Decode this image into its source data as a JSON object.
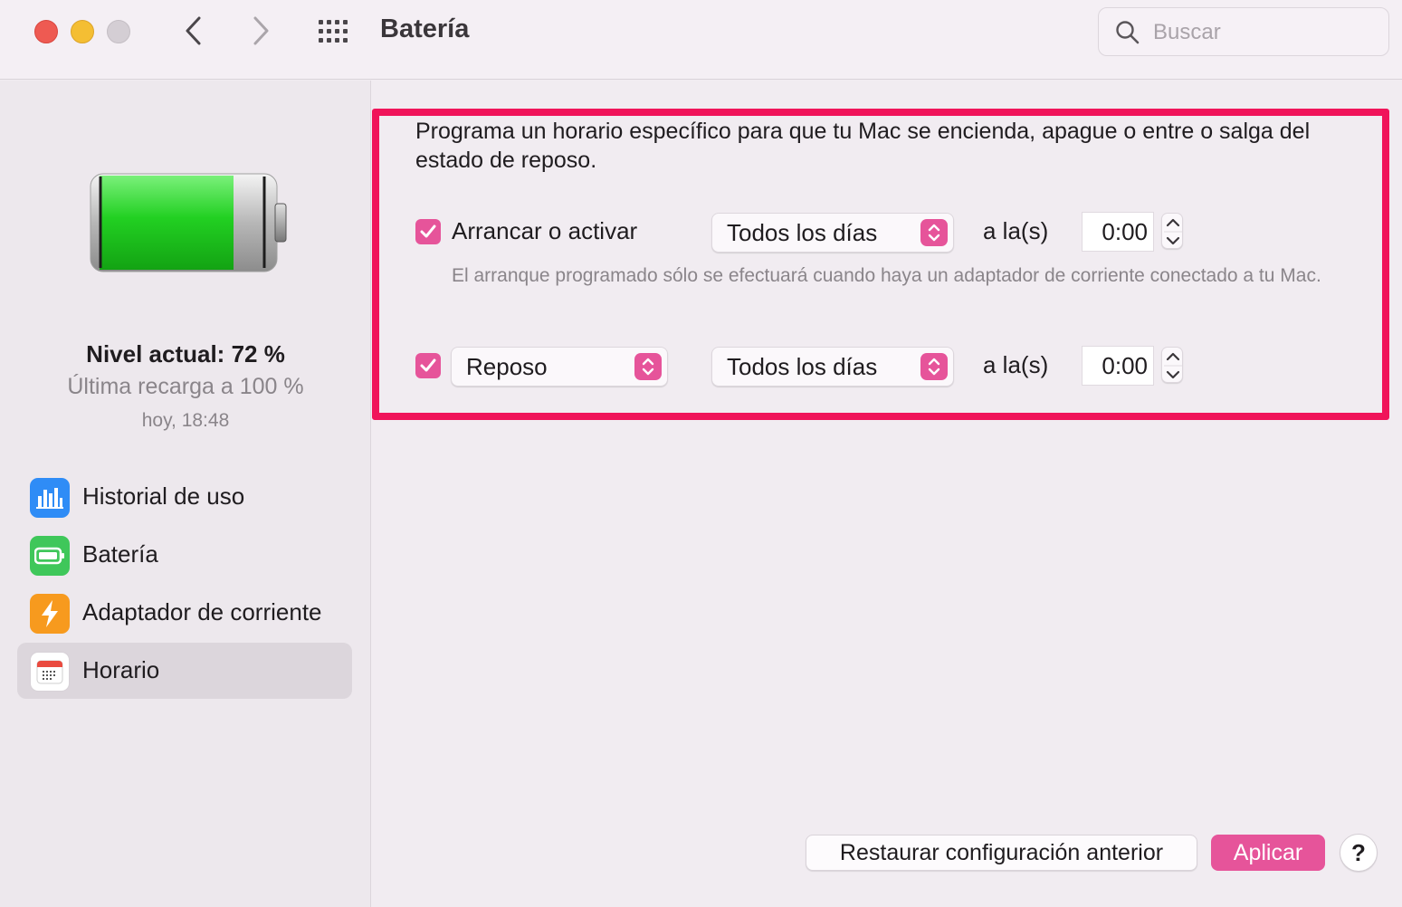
{
  "window": {
    "title": "Batería",
    "search_placeholder": "Buscar"
  },
  "sidebar": {
    "battery_level": "Nivel actual: 72 %",
    "battery_level_fraction": 0.72,
    "last_charge": "Última recarga a 100 %",
    "last_charge_time": "hoy, 18:48",
    "items": [
      {
        "label": "Historial de uso",
        "icon": "bar-chart-icon",
        "color": "#2f8cf6"
      },
      {
        "label": "Batería",
        "icon": "battery-icon",
        "color": "#3fc75a"
      },
      {
        "label": "Adaptador de corriente",
        "icon": "lightning-icon",
        "color": "#f79a1e"
      },
      {
        "label": "Horario",
        "icon": "calendar-icon",
        "color": "#ffffff",
        "selected": true
      }
    ]
  },
  "main": {
    "description": "Programa un horario específico para que tu Mac se encienda, apague o entre o salga del estado de reposo.",
    "row1": {
      "checked": true,
      "label": "Arrancar o activar",
      "frequency": "Todos los días",
      "at_label": "a la(s)",
      "time": "0:00"
    },
    "note": "El arranque programado sólo se efectuará cuando haya un adaptador de corriente conectado a tu Mac.",
    "row2": {
      "checked": true,
      "action": "Reposo",
      "frequency": "Todos los días",
      "at_label": "a la(s)",
      "time": "0:00"
    },
    "restore_button": "Restaurar configuración anterior",
    "apply_button": "Aplicar",
    "help_button": "?"
  },
  "colors": {
    "accent": "#e6549a",
    "highlight_border": "#f0145a",
    "battery_green": "#2fd02f"
  }
}
